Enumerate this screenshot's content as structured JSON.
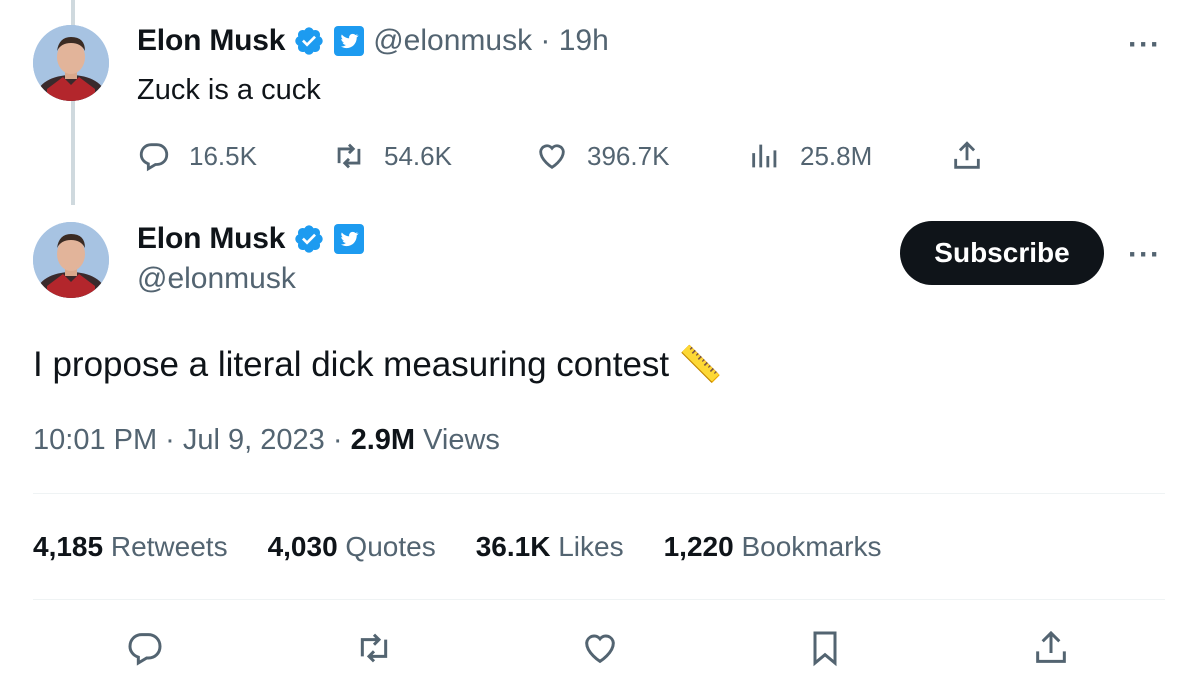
{
  "reply_tweet": {
    "author_name": "Elon Musk",
    "handle_time": "@elonmusk · 19h",
    "text": "Zuck is a cuck",
    "actions": {
      "replies": "16.5K",
      "retweets": "54.6K",
      "likes": "396.7K",
      "views": "25.8M"
    }
  },
  "main_tweet": {
    "author_name": "Elon Musk",
    "handle": "@elonmusk",
    "subscribe_label": "Subscribe",
    "text": "I propose a literal dick measuring contest",
    "emoji": "📏",
    "time_date": "10:01 PM · Jul 9, 2023 · ",
    "views_count": "2.9M",
    "views_label": " Views",
    "stats": [
      {
        "number": "4,185",
        "label": " Retweets"
      },
      {
        "number": "4,030",
        "label": " Quotes"
      },
      {
        "number": "36.1K",
        "label": " Likes"
      },
      {
        "number": "1,220",
        "label": " Bookmarks"
      }
    ]
  },
  "more_glyph": "···",
  "colors": {
    "verified": "#1d9bf0",
    "text": "#0f1419",
    "muted": "#536471",
    "subscribe_bg": "#0f1419"
  }
}
